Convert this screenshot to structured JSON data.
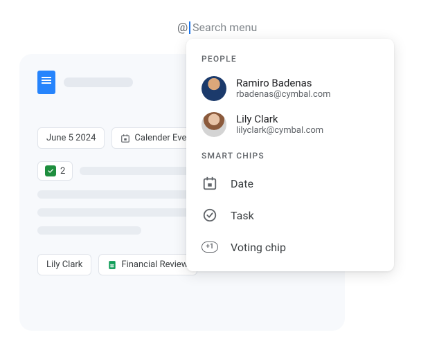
{
  "search": {
    "at": "@",
    "placeholder": "Search menu"
  },
  "doc": {
    "chips": {
      "date": "June 5 2024",
      "calendar_event": "Calender Event",
      "vote_count": "2",
      "person": "Lily Clark",
      "file": "Financial Review"
    }
  },
  "dropdown": {
    "sections": {
      "people": "PEOPLE",
      "smart_chips": "SMART CHIPS"
    },
    "people": [
      {
        "name": "Ramiro Badenas",
        "email": "rbadenas@cymbal.com"
      },
      {
        "name": "Lily Clark",
        "email": "lilyclark@cymbal.com"
      }
    ],
    "options": {
      "date": "Date",
      "task": "Task",
      "voting": "Voting chip",
      "voting_badge": "+1"
    }
  }
}
